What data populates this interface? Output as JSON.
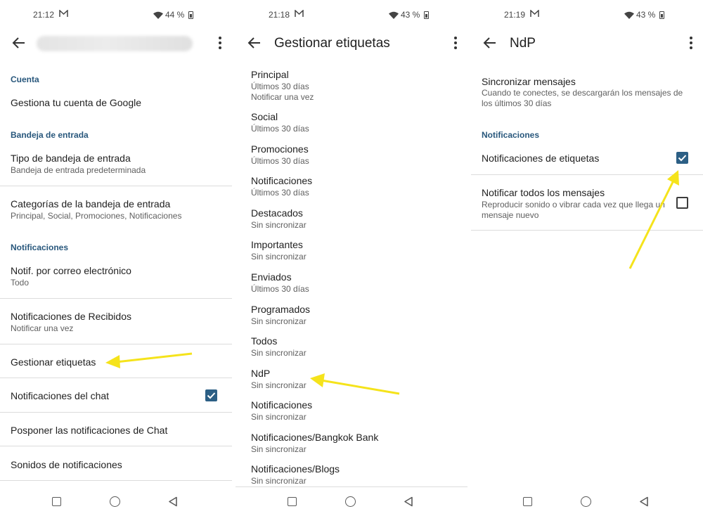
{
  "screens": [
    {
      "status": {
        "time": "21:12",
        "battery": "44 %"
      },
      "sections": {
        "cuenta": "Cuenta",
        "bandeja": "Bandeja de entrada",
        "notificaciones": "Notificaciones"
      },
      "items": {
        "cuenta_google": {
          "title": "Gestiona tu cuenta de Google"
        },
        "tipo_bandeja": {
          "title": "Tipo de bandeja de entrada",
          "subtitle": "Bandeja de entrada predeterminada"
        },
        "categorias": {
          "title": "Categorías de la bandeja de entrada",
          "subtitle": "Principal, Social, Promociones, Notificaciones"
        },
        "notif_correo": {
          "title": "Notif. por correo electrónico",
          "subtitle": "Todo"
        },
        "notif_recibidos": {
          "title": "Notificaciones de Recibidos",
          "subtitle": "Notificar una vez"
        },
        "gestionar": {
          "title": "Gestionar etiquetas"
        },
        "notif_chat": {
          "title": "Notificaciones del chat",
          "checked": true
        },
        "posponer": {
          "title": "Posponer las notificaciones de Chat"
        },
        "sonidos": {
          "title": "Sonidos de notificaciones"
        }
      }
    },
    {
      "status": {
        "time": "21:18",
        "battery": "43 %"
      },
      "title": "Gestionar etiquetas",
      "labels": [
        {
          "name": "Principal",
          "sync": "Últimos 30 días",
          "extra": "Notificar una vez"
        },
        {
          "name": "Social",
          "sync": "Últimos 30 días"
        },
        {
          "name": "Promociones",
          "sync": "Últimos 30 días"
        },
        {
          "name": "Notificaciones",
          "sync": "Últimos 30 días"
        },
        {
          "name": "Destacados",
          "sync": "Sin sincronizar"
        },
        {
          "name": "Importantes",
          "sync": "Sin sincronizar"
        },
        {
          "name": "Enviados",
          "sync": "Últimos 30 días"
        },
        {
          "name": "Programados",
          "sync": "Sin sincronizar"
        },
        {
          "name": "Todos",
          "sync": "Sin sincronizar"
        },
        {
          "name": "NdP",
          "sync": "Sin sincronizar"
        },
        {
          "name": "Notificaciones",
          "sync": "Sin sincronizar"
        },
        {
          "name": "Notificaciones/Bangkok Bank",
          "sync": "Sin sincronizar"
        },
        {
          "name": "Notificaciones/Blogs",
          "sync": "Sin sincronizar"
        }
      ]
    },
    {
      "status": {
        "time": "21:19",
        "battery": "43 %"
      },
      "title": "NdP",
      "sync": {
        "title": "Sincronizar mensajes",
        "subtitle": "Cuando te conectes, se descargarán los mensajes de los últimos 30 días"
      },
      "section": "Notificaciones",
      "notif_etiquetas": {
        "title": "Notificaciones de etiquetas",
        "checked": true
      },
      "notif_todos": {
        "title": "Notificar todos los mensajes",
        "subtitle": "Reproducir sonido o vibrar cada vez que llega un mensaje nuevo",
        "checked": false
      }
    }
  ],
  "colors": {
    "accent": "#2c5f85",
    "section": "#28577c",
    "annotation_arrow": "#f5e31b"
  },
  "icons": [
    "back-arrow-icon",
    "more-vert-icon",
    "mail-icon",
    "wifi-icon",
    "battery-icon",
    "check-icon",
    "nav-recents-icon",
    "nav-home-icon",
    "nav-back-icon"
  ]
}
